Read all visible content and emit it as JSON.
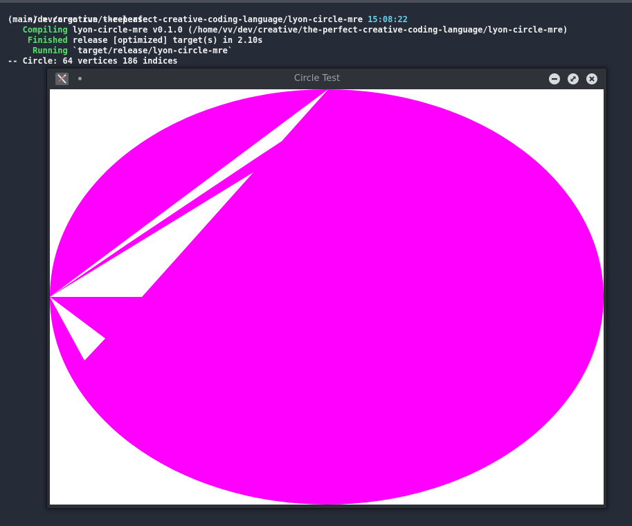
{
  "terminal": {
    "line1": {
      "path": "~/dev/creative/the-perfect-creative-coding-language/lyon-circle-mre",
      "time": "15:08:22"
    },
    "line2": "(main) > cargo run --release",
    "line3": {
      "keyword": "   Compiling",
      "text": " lyon-circle-mre v0.1.0 (/home/vv/dev/creative/the-perfect-creative-coding-language/lyon-circle-mre)"
    },
    "line4": {
      "keyword": "    Finished",
      "text": " release [optimized] target(s) in 2.10s"
    },
    "line5": {
      "keyword": "     Running",
      "text": " `target/release/lyon-circle-mre`"
    },
    "line6": "-- Circle: 64 vertices 186 indices"
  },
  "window": {
    "title": "Circle Test",
    "buttons": {
      "minimize": "minimize-icon",
      "maximize": "maximize-icon",
      "close": "close-icon"
    }
  },
  "colors": {
    "background": "#252b37",
    "shape_fill": "#ff00ff",
    "canvas": "#ffffff",
    "green": "#58e06c",
    "cyan": "#64d2e8"
  }
}
